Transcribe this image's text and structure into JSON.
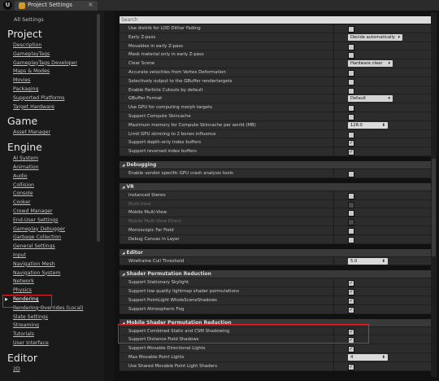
{
  "window": {
    "tab_title": "Project Settings",
    "close_glyph": "×",
    "logo_glyph": "U"
  },
  "search": {
    "placeholder": "Search"
  },
  "left": {
    "all_settings": "All Settings",
    "groups": [
      {
        "title": "Project",
        "items": [
          "Description",
          "GameplayTags",
          "GameplayTags Developer",
          "Maps & Modes",
          "Movies",
          "Packaging",
          "Supported Platforms",
          "Target Hardware"
        ]
      },
      {
        "title": "Game",
        "items": [
          "Asset Manager"
        ]
      },
      {
        "title": "Engine",
        "items": [
          "AI System",
          "Animation",
          "Audio",
          "Collision",
          "Console",
          "Cooker",
          "Crowd Manager",
          "End-User Settings",
          "Gameplay Debugger",
          "Garbage Collection",
          "General Settings",
          "Input",
          "Navigation Mesh",
          "Navigation System",
          "Network",
          "Physics",
          "Rendering",
          "Rendering Overrides (Local)",
          "Slate Settings",
          "Streaming",
          "Tutorials",
          "User Interface"
        ]
      },
      {
        "title": "Editor",
        "items": [
          "2D"
        ]
      }
    ],
    "selected_item": "Rendering"
  },
  "props": {
    "rows_top": [
      {
        "label": "Use distrib for LOD Dither Fading",
        "kind": "checkbox",
        "checked": false
      },
      {
        "label": "Early Z-pass",
        "kind": "dropdown",
        "value": "Decide automatically"
      },
      {
        "label": "Movables in early Z-pass",
        "kind": "checkbox",
        "checked": false
      },
      {
        "label": "Mask material only in early Z-pass",
        "kind": "checkbox",
        "checked": false
      },
      {
        "label": "Clear Scene",
        "kind": "dropdown",
        "value": "Hardware clear"
      },
      {
        "label": "Accurate velocities from Vertex Deformation",
        "kind": "checkbox",
        "checked": false
      },
      {
        "label": "Selectively output to the GBuffer rendertargets",
        "kind": "checkbox",
        "checked": false
      },
      {
        "label": "Enable Particle Cutouts by default",
        "kind": "checkbox",
        "checked": false
      },
      {
        "label": "GBuffer Format",
        "kind": "dropdown",
        "value": "Default"
      },
      {
        "label": "Use GPU for computing morph targets",
        "kind": "checkbox",
        "checked": false
      },
      {
        "label": "Support Compute Skincache",
        "kind": "checkbox",
        "checked": false
      },
      {
        "label": "Maximum memory for Compute Skincache per world (MB)",
        "kind": "number",
        "value": "128.0"
      },
      {
        "label": "Limit GPU skinning to 2 bones influence",
        "kind": "checkbox",
        "checked": false
      },
      {
        "label": "Support depth-only index buffers",
        "kind": "checkbox",
        "checked": true
      },
      {
        "label": "Support reversed index buffers",
        "kind": "checkbox",
        "checked": true
      }
    ],
    "sections": [
      {
        "title": "Debugging",
        "rows": [
          {
            "label": "Enable vendor specific GPU crash analysis tools",
            "kind": "checkbox",
            "checked": false
          }
        ]
      },
      {
        "title": "VR",
        "rows": [
          {
            "label": "Instanced Stereo",
            "kind": "checkbox",
            "checked": false
          },
          {
            "label": "Multi-View",
            "kind": "checkbox",
            "checked": false,
            "dim": true
          },
          {
            "label": "Mobile Multi-View",
            "kind": "checkbox",
            "checked": false
          },
          {
            "label": "Mobile Multi-View Direct",
            "kind": "checkbox",
            "checked": false,
            "dim": true
          },
          {
            "label": "Monoscopic Far Field",
            "kind": "checkbox",
            "checked": false
          },
          {
            "label": "Debug Canvas in Layer",
            "kind": "checkbox",
            "checked": false
          }
        ]
      },
      {
        "title": "Editor",
        "rows": [
          {
            "label": "Wireframe Cull Threshold",
            "kind": "number",
            "value": "5.0"
          }
        ]
      },
      {
        "title": "Shader Permutation Reduction",
        "rows": [
          {
            "label": "Support Stationary Skylight",
            "kind": "checkbox",
            "checked": true
          },
          {
            "label": "Support low quality lightmap shader permutations",
            "kind": "checkbox",
            "checked": true
          },
          {
            "label": "Support PointLight WholeSceneShadows",
            "kind": "checkbox",
            "checked": true
          },
          {
            "label": "Support Atmospheric Fog",
            "kind": "checkbox",
            "checked": true
          }
        ]
      },
      {
        "title": "Mobile Shader Permutation Reduction",
        "rows": [
          {
            "label": "Support Combined Static and CSM Shadowing",
            "kind": "checkbox",
            "checked": true
          },
          {
            "label": "Support Distance Field Shadows",
            "kind": "checkbox",
            "checked": true
          },
          {
            "label": "Support Movable Directional Lights",
            "kind": "checkbox",
            "checked": true
          },
          {
            "label": "Max Movable Point Lights",
            "kind": "number",
            "value": "4"
          },
          {
            "label": "Use Shared Movable Point Light Shaders",
            "kind": "checkbox",
            "checked": true
          }
        ]
      }
    ],
    "check_glyph": "✓",
    "dropdown_glyph": "▾",
    "spin_glyph": "⬍",
    "section_glyph": "◢"
  },
  "colors": {
    "highlight_box": "#e2232a",
    "tab_icon": "#d59a2a"
  }
}
